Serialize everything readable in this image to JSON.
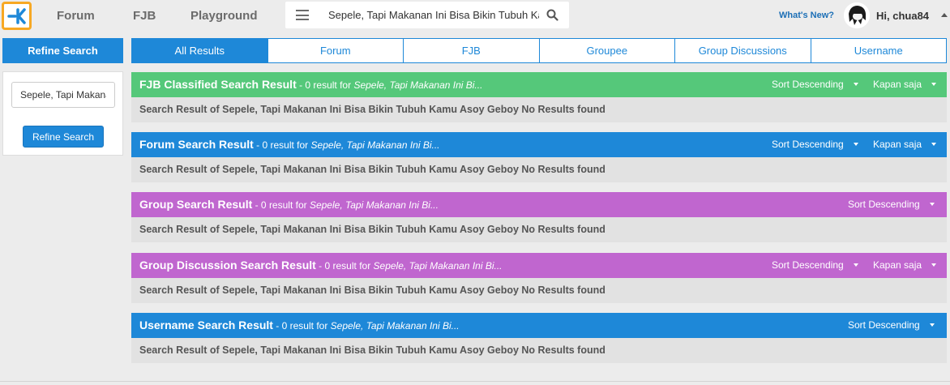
{
  "nav": {
    "links": [
      "Forum",
      "FJB",
      "Playground"
    ],
    "search_value": "Sepele, Tapi Makanan Ini Bisa Bikin Tubuh Kam",
    "whats_new": "What's New?",
    "greeting": "Hi, chua84"
  },
  "sidebar": {
    "header": "Refine Search",
    "input_value": "Sepele, Tapi Makana",
    "button": "Refine Search"
  },
  "tabs": [
    "All Results",
    "Forum",
    "FJB",
    "Groupee",
    "Group Discussions",
    "Username"
  ],
  "sections": [
    {
      "title": "FJB Classified Search Result",
      "count_text": " - 0 result for ",
      "query": "Sepele, Tapi Makanan Ini Bi...",
      "sort": "Sort Descending",
      "time": "Kapan saja",
      "body": "Search Result of Sepele, Tapi Makanan Ini Bisa Bikin Tubuh Kamu Asoy Geboy No Results found"
    },
    {
      "title": "Forum Search Result",
      "count_text": " - 0 result for ",
      "query": "Sepele, Tapi Makanan Ini Bi...",
      "sort": "Sort Descending",
      "time": "Kapan saja",
      "body": "Search Result of Sepele, Tapi Makanan Ini Bisa Bikin Tubuh Kamu Asoy Geboy No Results found"
    },
    {
      "title": "Group Search Result",
      "count_text": " - 0 result for ",
      "query": "Sepele, Tapi Makanan Ini Bi...",
      "sort": "Sort Descending",
      "body": "Search Result of Sepele, Tapi Makanan Ini Bisa Bikin Tubuh Kamu Asoy Geboy No Results found"
    },
    {
      "title": "Group Discussion Search Result",
      "count_text": " - 0 result for ",
      "query": "Sepele, Tapi Makanan Ini Bi...",
      "sort": "Sort Descending",
      "time": "Kapan saja",
      "body": "Search Result of Sepele, Tapi Makanan Ini Bisa Bikin Tubuh Kamu Asoy Geboy No Results found"
    },
    {
      "title": "Username Search Result",
      "count_text": " - 0 result for ",
      "query": "Sepele, Tapi Makanan Ini Bi...",
      "sort": "Sort Descending",
      "body": "Search Result of Sepele, Tapi Makanan Ini Bisa Bikin Tubuh Kamu Asoy Geboy No Results found"
    }
  ],
  "colors": {
    "accent_blue": "#1e88d8",
    "green": "#55c87a",
    "purple": "#c066cf",
    "logo_border": "#f7a823"
  },
  "icons": [
    "kaskus-logo-icon",
    "hamburger-menu-icon",
    "search-icon",
    "avatar",
    "chevron-up-icon",
    "caret-down-icon"
  ]
}
